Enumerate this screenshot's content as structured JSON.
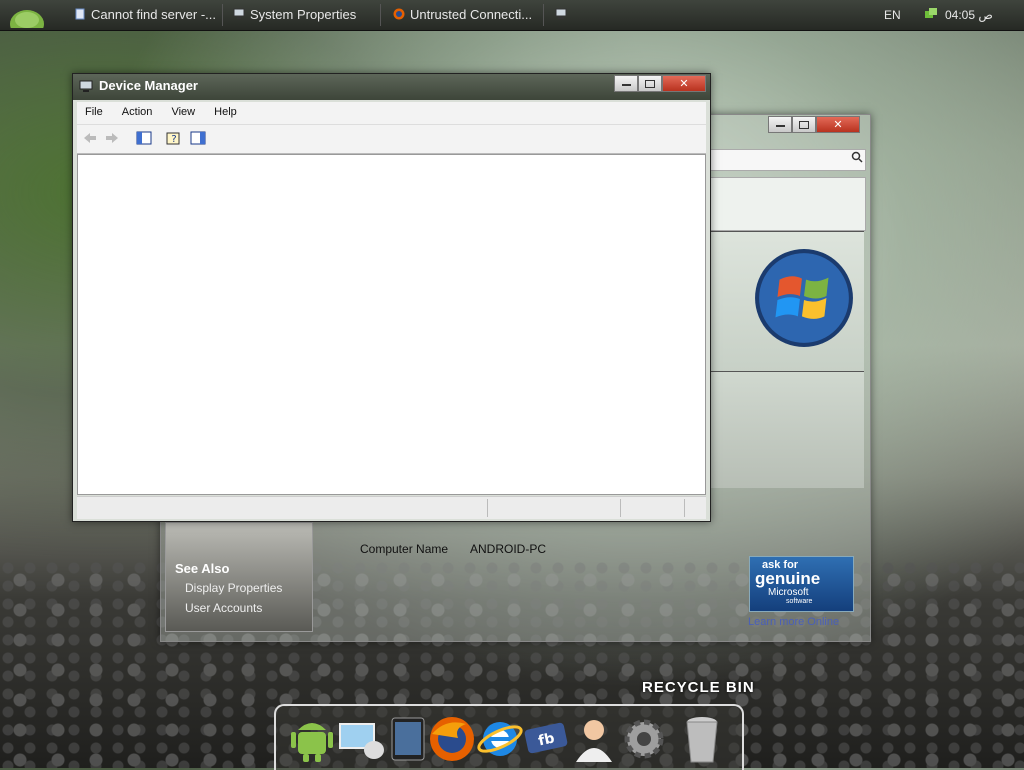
{
  "taskbar": {
    "tasks": [
      {
        "label": "Cannot find server -..."
      },
      {
        "label": "System Properties"
      },
      {
        "label": "Untrusted Connecti..."
      }
    ],
    "language": "EN",
    "clock": "04:05 ص"
  },
  "device_manager": {
    "title": "Device Manager",
    "menu": [
      "File",
      "Action",
      "View",
      "Help"
    ]
  },
  "system_properties": {
    "see_also": "See Also",
    "links": [
      "Display Properties",
      "User Accounts"
    ],
    "computer_name_label": "Computer Name",
    "computer_name_value": "ANDROID-PC",
    "genuine": {
      "line1": "ask for",
      "line2": "genuine",
      "line3": "Microsoft",
      "line4": "software"
    },
    "learn_more": "Learn more Online"
  },
  "desktop": {
    "recycle_bin": "RECYCLE BIN"
  },
  "dock": [
    "android",
    "network",
    "tablet",
    "firefox",
    "internet-explorer",
    "facebook",
    "user",
    "settings",
    "recycle-bin"
  ],
  "colors": {
    "taskbar": "#2f332d",
    "titlebar": "#4a5246",
    "close": "#c8402b"
  }
}
